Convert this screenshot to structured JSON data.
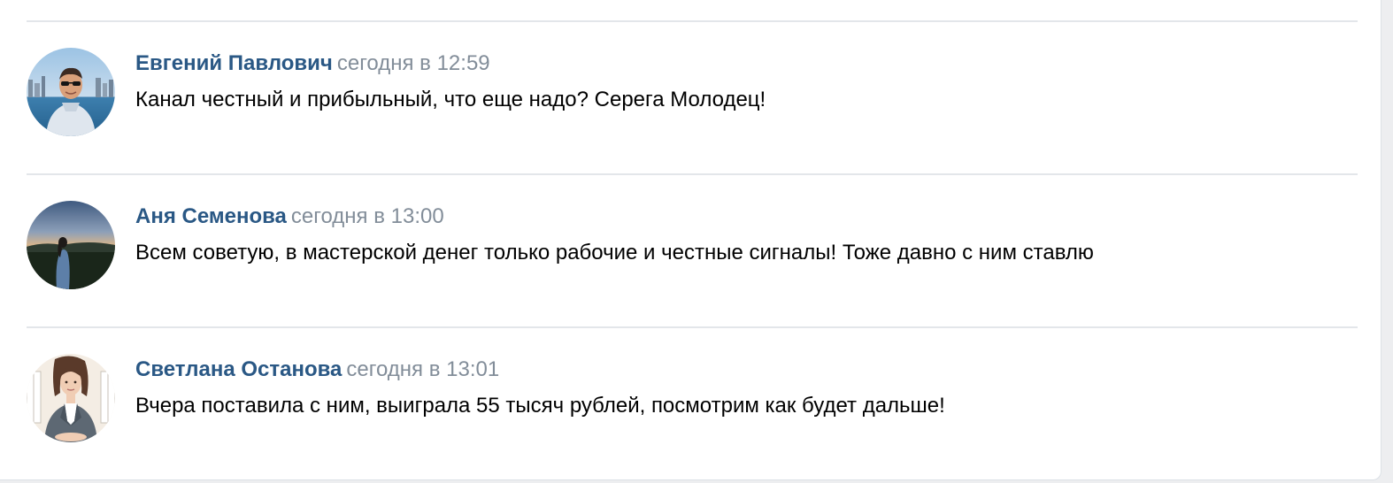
{
  "comments": [
    {
      "author": "Евгений Павлович",
      "time": "сегодня в 12:59",
      "text": "Канал честный и прибыльный, что еще надо? Серега Молодец!"
    },
    {
      "author": "Аня Семенова",
      "time": "сегодня в 13:00",
      "text": "Всем советую, в мастерской денег только рабочие и честные сигналы! Тоже давно с ним ставлю"
    },
    {
      "author": "Светлана Останова",
      "time": "сегодня в 13:01",
      "text": "Вчера поставила с ним, выиграла 55 тысяч рублей, посмотрим как будет дальше!"
    }
  ],
  "colors": {
    "author": "#2a5885",
    "time": "#828d99",
    "text": "#000000",
    "divider": "#e3e6ea"
  }
}
